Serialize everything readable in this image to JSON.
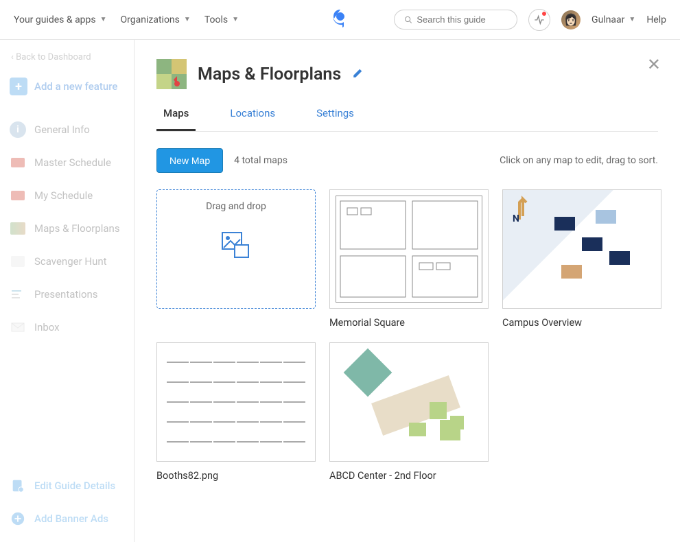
{
  "header": {
    "nav": [
      {
        "label": "Your guides & apps"
      },
      {
        "label": "Organizations"
      },
      {
        "label": "Tools"
      }
    ],
    "search_placeholder": "Search this guide",
    "user_name": "Gulnaar",
    "help": "Help"
  },
  "sidebar": {
    "back": "‹ Back to Dashboard",
    "add_feature": "Add a new feature",
    "items": [
      {
        "label": "General Info"
      },
      {
        "label": "Master Schedule"
      },
      {
        "label": "My Schedule"
      },
      {
        "label": "Maps & Floorplans"
      },
      {
        "label": "Scavenger Hunt"
      },
      {
        "label": "Presentations"
      },
      {
        "label": "Inbox"
      }
    ],
    "bottom": [
      {
        "label": "Edit Guide Details"
      },
      {
        "label": "Add Banner Ads"
      }
    ]
  },
  "content": {
    "title": "Maps & Floorplans",
    "tabs": [
      {
        "label": "Maps",
        "active": true
      },
      {
        "label": "Locations",
        "active": false
      },
      {
        "label": "Settings",
        "active": false
      }
    ],
    "new_map": "New Map",
    "total": "4 total maps",
    "hint": "Click on any map to edit, drag to sort.",
    "drop_label": "Drag and drop",
    "maps": [
      {
        "label": "Memorial Square"
      },
      {
        "label": "Campus Overview"
      },
      {
        "label": "Booths82.png"
      },
      {
        "label": "ABCD Center - 2nd Floor"
      }
    ]
  }
}
